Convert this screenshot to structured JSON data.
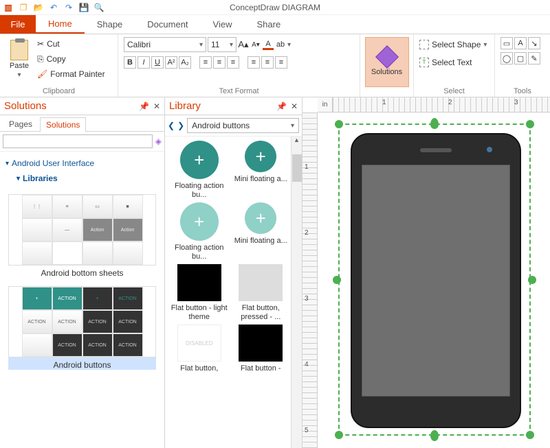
{
  "app": {
    "title": "ConceptDraw DIAGRAM"
  },
  "qat_icons": [
    "app-icon",
    "new-doc-icon",
    "open-icon",
    "undo-icon",
    "redo-icon",
    "save-icon",
    "search-icon"
  ],
  "tabs": {
    "file": "File",
    "items": [
      "Home",
      "Shape",
      "Document",
      "View",
      "Share"
    ],
    "active": "Home"
  },
  "ribbon": {
    "clipboard": {
      "label": "Clipboard",
      "paste": "Paste",
      "cut": "Cut",
      "copy": "Copy",
      "format_painter": "Format Painter"
    },
    "text_format": {
      "label": "Text Format",
      "font": "Calibri",
      "size": "11",
      "buttons": [
        "B",
        "I",
        "U",
        "A²",
        "A₂",
        "≡",
        "≡",
        "≡",
        "≡",
        "≡",
        "≡"
      ]
    },
    "solutions": {
      "label": "Solutions"
    },
    "select": {
      "label": "Select",
      "select_shape": "Select Shape",
      "select_text": "Select Text"
    },
    "tools": {
      "label": "Tools"
    }
  },
  "solutions_panel": {
    "title": "Solutions",
    "tabs": [
      "Pages",
      "Solutions"
    ],
    "active_tab": "Solutions",
    "tree": {
      "root": "Android User Interface",
      "child": "Libraries"
    },
    "thumbs": [
      {
        "label": "Android bottom sheets",
        "cells": [
          "",
          "",
          "",
          "",
          "",
          "",
          "Action",
          "Action",
          "",
          "",
          "",
          ""
        ]
      },
      {
        "label": "Android buttons",
        "cells": [
          "+",
          "ACTION",
          "+",
          "ACTION",
          "ACTION",
          "ACTION",
          "ACTION",
          "ACTION",
          "",
          "ACTION",
          "ACTION",
          "ACTION"
        ],
        "selected": true
      }
    ]
  },
  "library_panel": {
    "title": "Library",
    "combo": "Android buttons",
    "items": [
      {
        "kind": "fab-dark",
        "label": "Floating action bu..."
      },
      {
        "kind": "fab-dark",
        "label": "Mini floating a..."
      },
      {
        "kind": "fab-light",
        "label": "Floating action bu..."
      },
      {
        "kind": "fab-light",
        "label": "Mini floating a..."
      },
      {
        "kind": "flat-black",
        "label": "Flat button - light theme"
      },
      {
        "kind": "flat-grey",
        "label": "Flat button, pressed - ..."
      },
      {
        "kind": "flat-black2",
        "label": "Flat button,"
      },
      {
        "kind": "flat-black2",
        "label": "Flat button -"
      }
    ]
  },
  "ruler": {
    "unit": "in",
    "h_numbers": [
      "1",
      "2",
      "3"
    ],
    "v_numbers": [
      "1",
      "2",
      "3",
      "4",
      "5"
    ]
  }
}
